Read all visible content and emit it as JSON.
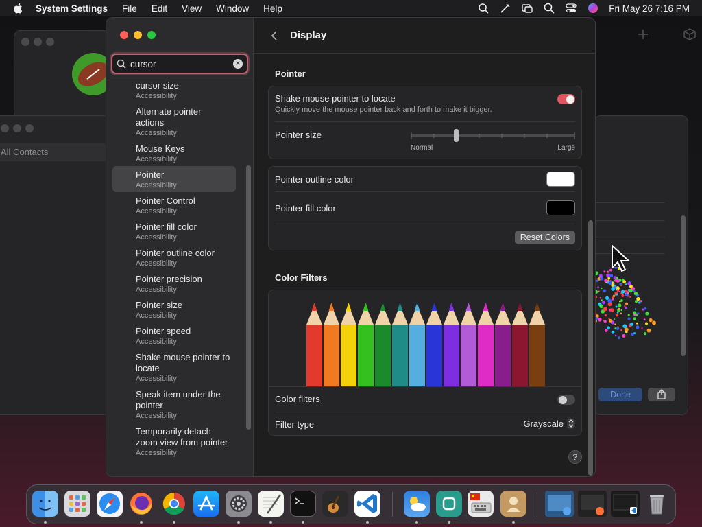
{
  "menubar": {
    "app": "System Settings",
    "menus": [
      "File",
      "Edit",
      "View",
      "Window",
      "Help"
    ],
    "clock": "Fri May 26  7:16 PM"
  },
  "background": {
    "contacts_label": "All Contacts",
    "done_label": "Done"
  },
  "sidebar": {
    "search_value": "cursor",
    "results": [
      {
        "title": "cursor size",
        "subtitle": "Accessibility"
      },
      {
        "title": "Alternate pointer actions",
        "subtitle": "Accessibility"
      },
      {
        "title": "Mouse Keys",
        "subtitle": "Accessibility"
      },
      {
        "title": "Pointer",
        "subtitle": "Accessibility"
      },
      {
        "title": "Pointer Control",
        "subtitle": "Accessibility"
      },
      {
        "title": "Pointer fill color",
        "subtitle": "Accessibility"
      },
      {
        "title": "Pointer outline color",
        "subtitle": "Accessibility"
      },
      {
        "title": "Pointer precision",
        "subtitle": "Accessibility"
      },
      {
        "title": "Pointer size",
        "subtitle": "Accessibility"
      },
      {
        "title": "Pointer speed",
        "subtitle": "Accessibility"
      },
      {
        "title": "Shake mouse pointer to locate",
        "subtitle": "Accessibility"
      },
      {
        "title": "Speak item under the pointer",
        "subtitle": "Accessibility"
      },
      {
        "title": "Temporarily detach zoom view from pointer",
        "subtitle": "Accessibility"
      }
    ]
  },
  "detail": {
    "title": "Display",
    "pointer_section": "Pointer",
    "shake_label": "Shake mouse pointer to locate",
    "shake_desc": "Quickly move the mouse pointer back and forth to make it bigger.",
    "shake_on": true,
    "pointer_size_label": "Pointer size",
    "pointer_size_min": "Normal",
    "pointer_size_max": "Large",
    "pointer_size_value": 0.27,
    "outline_color_label": "Pointer outline color",
    "outline_color": "#ffffff",
    "fill_color_label": "Pointer fill color",
    "fill_color": "#000000",
    "reset_label": "Reset Colors",
    "color_filters_section": "Color Filters",
    "color_filters_label": "Color filters",
    "color_filters_on": false,
    "filter_type_label": "Filter type",
    "filter_type_value": "Grayscale",
    "help": "?"
  },
  "colors": {
    "toggle_on": "#e0545f",
    "search_focus": "#b86674"
  }
}
